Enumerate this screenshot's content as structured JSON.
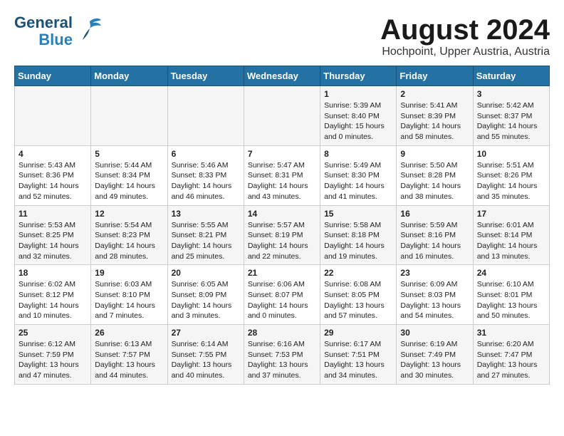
{
  "header": {
    "logo_line1": "General",
    "logo_line2": "Blue",
    "month": "August 2024",
    "location": "Hochpoint, Upper Austria, Austria"
  },
  "weekdays": [
    "Sunday",
    "Monday",
    "Tuesday",
    "Wednesday",
    "Thursday",
    "Friday",
    "Saturday"
  ],
  "weeks": [
    [
      {
        "day": "",
        "info": ""
      },
      {
        "day": "",
        "info": ""
      },
      {
        "day": "",
        "info": ""
      },
      {
        "day": "",
        "info": ""
      },
      {
        "day": "1",
        "info": "Sunrise: 5:39 AM\nSunset: 8:40 PM\nDaylight: 15 hours\nand 0 minutes."
      },
      {
        "day": "2",
        "info": "Sunrise: 5:41 AM\nSunset: 8:39 PM\nDaylight: 14 hours\nand 58 minutes."
      },
      {
        "day": "3",
        "info": "Sunrise: 5:42 AM\nSunset: 8:37 PM\nDaylight: 14 hours\nand 55 minutes."
      }
    ],
    [
      {
        "day": "4",
        "info": "Sunrise: 5:43 AM\nSunset: 8:36 PM\nDaylight: 14 hours\nand 52 minutes."
      },
      {
        "day": "5",
        "info": "Sunrise: 5:44 AM\nSunset: 8:34 PM\nDaylight: 14 hours\nand 49 minutes."
      },
      {
        "day": "6",
        "info": "Sunrise: 5:46 AM\nSunset: 8:33 PM\nDaylight: 14 hours\nand 46 minutes."
      },
      {
        "day": "7",
        "info": "Sunrise: 5:47 AM\nSunset: 8:31 PM\nDaylight: 14 hours\nand 43 minutes."
      },
      {
        "day": "8",
        "info": "Sunrise: 5:49 AM\nSunset: 8:30 PM\nDaylight: 14 hours\nand 41 minutes."
      },
      {
        "day": "9",
        "info": "Sunrise: 5:50 AM\nSunset: 8:28 PM\nDaylight: 14 hours\nand 38 minutes."
      },
      {
        "day": "10",
        "info": "Sunrise: 5:51 AM\nSunset: 8:26 PM\nDaylight: 14 hours\nand 35 minutes."
      }
    ],
    [
      {
        "day": "11",
        "info": "Sunrise: 5:53 AM\nSunset: 8:25 PM\nDaylight: 14 hours\nand 32 minutes."
      },
      {
        "day": "12",
        "info": "Sunrise: 5:54 AM\nSunset: 8:23 PM\nDaylight: 14 hours\nand 28 minutes."
      },
      {
        "day": "13",
        "info": "Sunrise: 5:55 AM\nSunset: 8:21 PM\nDaylight: 14 hours\nand 25 minutes."
      },
      {
        "day": "14",
        "info": "Sunrise: 5:57 AM\nSunset: 8:19 PM\nDaylight: 14 hours\nand 22 minutes."
      },
      {
        "day": "15",
        "info": "Sunrise: 5:58 AM\nSunset: 8:18 PM\nDaylight: 14 hours\nand 19 minutes."
      },
      {
        "day": "16",
        "info": "Sunrise: 5:59 AM\nSunset: 8:16 PM\nDaylight: 14 hours\nand 16 minutes."
      },
      {
        "day": "17",
        "info": "Sunrise: 6:01 AM\nSunset: 8:14 PM\nDaylight: 14 hours\nand 13 minutes."
      }
    ],
    [
      {
        "day": "18",
        "info": "Sunrise: 6:02 AM\nSunset: 8:12 PM\nDaylight: 14 hours\nand 10 minutes."
      },
      {
        "day": "19",
        "info": "Sunrise: 6:03 AM\nSunset: 8:10 PM\nDaylight: 14 hours\nand 7 minutes."
      },
      {
        "day": "20",
        "info": "Sunrise: 6:05 AM\nSunset: 8:09 PM\nDaylight: 14 hours\nand 3 minutes."
      },
      {
        "day": "21",
        "info": "Sunrise: 6:06 AM\nSunset: 8:07 PM\nDaylight: 14 hours\nand 0 minutes."
      },
      {
        "day": "22",
        "info": "Sunrise: 6:08 AM\nSunset: 8:05 PM\nDaylight: 13 hours\nand 57 minutes."
      },
      {
        "day": "23",
        "info": "Sunrise: 6:09 AM\nSunset: 8:03 PM\nDaylight: 13 hours\nand 54 minutes."
      },
      {
        "day": "24",
        "info": "Sunrise: 6:10 AM\nSunset: 8:01 PM\nDaylight: 13 hours\nand 50 minutes."
      }
    ],
    [
      {
        "day": "25",
        "info": "Sunrise: 6:12 AM\nSunset: 7:59 PM\nDaylight: 13 hours\nand 47 minutes."
      },
      {
        "day": "26",
        "info": "Sunrise: 6:13 AM\nSunset: 7:57 PM\nDaylight: 13 hours\nand 44 minutes."
      },
      {
        "day": "27",
        "info": "Sunrise: 6:14 AM\nSunset: 7:55 PM\nDaylight: 13 hours\nand 40 minutes."
      },
      {
        "day": "28",
        "info": "Sunrise: 6:16 AM\nSunset: 7:53 PM\nDaylight: 13 hours\nand 37 minutes."
      },
      {
        "day": "29",
        "info": "Sunrise: 6:17 AM\nSunset: 7:51 PM\nDaylight: 13 hours\nand 34 minutes."
      },
      {
        "day": "30",
        "info": "Sunrise: 6:19 AM\nSunset: 7:49 PM\nDaylight: 13 hours\nand 30 minutes."
      },
      {
        "day": "31",
        "info": "Sunrise: 6:20 AM\nSunset: 7:47 PM\nDaylight: 13 hours\nand 27 minutes."
      }
    ]
  ]
}
